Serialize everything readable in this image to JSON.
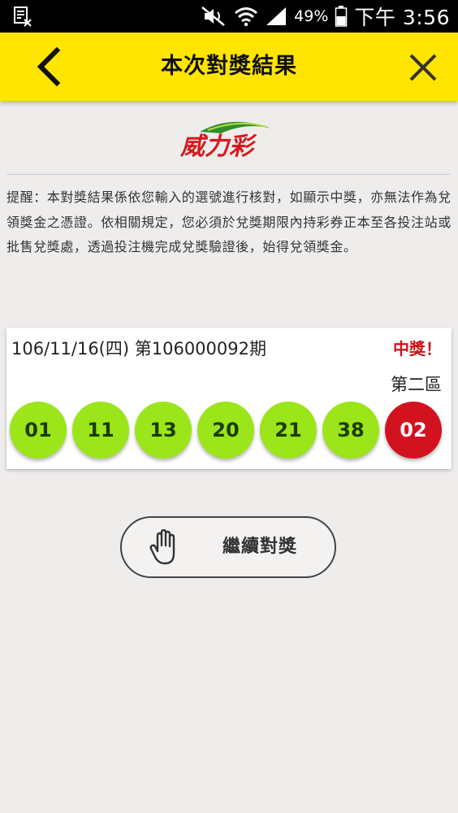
{
  "status_bar": {
    "battery_percent": "49%",
    "time": "下午 3:56",
    "icons": [
      "sim-info-icon",
      "mute-icon",
      "wifi-icon",
      "signal-icon",
      "battery-icon"
    ]
  },
  "header": {
    "title": "本次對獎結果",
    "back_icon": "chevron-left-icon",
    "close_icon": "close-icon",
    "background_color": "#ffe500"
  },
  "logo": {
    "text": "威力彩"
  },
  "notice": {
    "text": "提醒：本對獎結果係依您輸入的選號進行核對，如顯示中獎，亦無法作為兌領獎金之憑證。依相關規定，您必須於兌獎期限內持彩券正本至各投注站或批售兌獎處，透過投注機完成兌獎驗證後，始得兌領獎金。"
  },
  "result": {
    "draw_info": "106/11/16(四) 第106000092期",
    "win_label": "中獎！",
    "zone_label": "第二區",
    "numbers": [
      "01",
      "11",
      "13",
      "20",
      "21",
      "38"
    ],
    "special_number": "02",
    "ball_color": "#9be51a",
    "special_ball_color": "#d31220",
    "win_color": "#d0111b"
  },
  "actions": {
    "continue_label": "繼續對獎",
    "continue_icon": "hand-icon"
  }
}
